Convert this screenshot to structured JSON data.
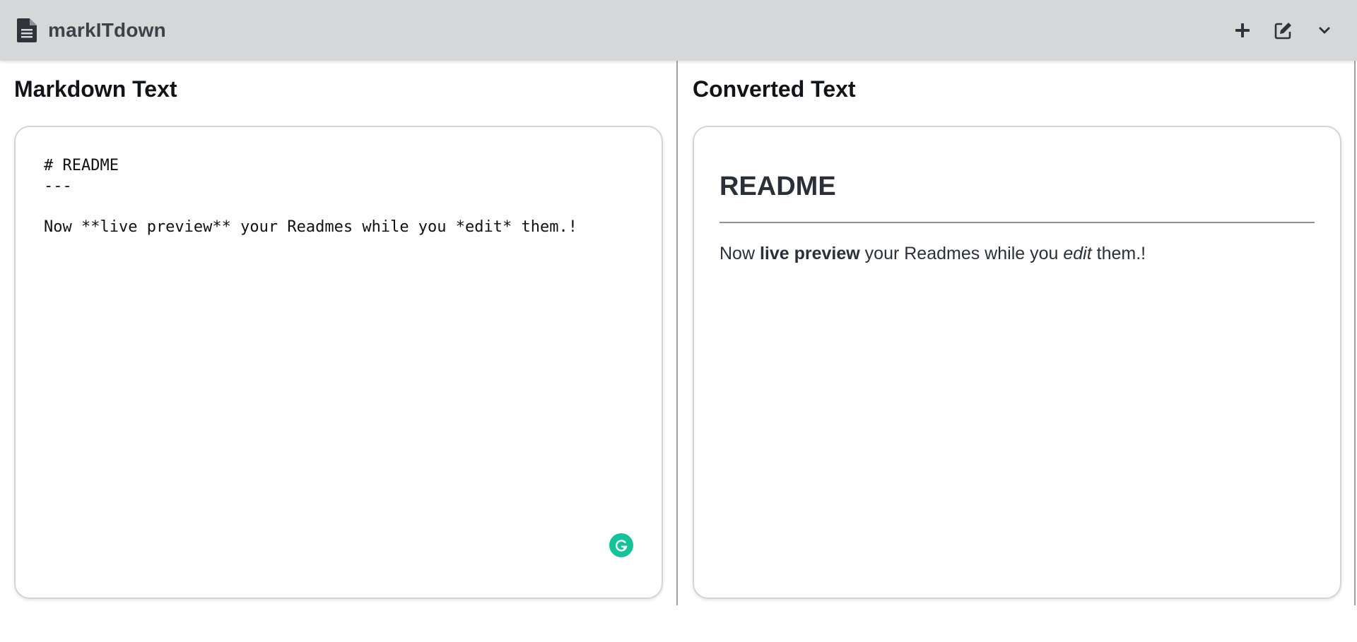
{
  "app": {
    "name": "markITdown",
    "icon": "document-icon"
  },
  "toolbar": {
    "actions": [
      {
        "id": "new",
        "icon": "plus-icon"
      },
      {
        "id": "edit",
        "icon": "edit-icon"
      },
      {
        "id": "menu",
        "icon": "chevron-down-icon"
      }
    ]
  },
  "editor_pane": {
    "title": "Markdown Text",
    "content": "# README\n---\n\nNow **live preview** your Readmes while you *edit* them.!",
    "extension_icon": "grammarly-icon",
    "extension_color": "#15c39a"
  },
  "preview_pane": {
    "title": "Converted Text",
    "heading": "README",
    "paragraph": {
      "t1": "Now ",
      "bold": "live preview",
      "t2": " your Readmes while you ",
      "italic": "edit",
      "t3": " them.!"
    }
  }
}
